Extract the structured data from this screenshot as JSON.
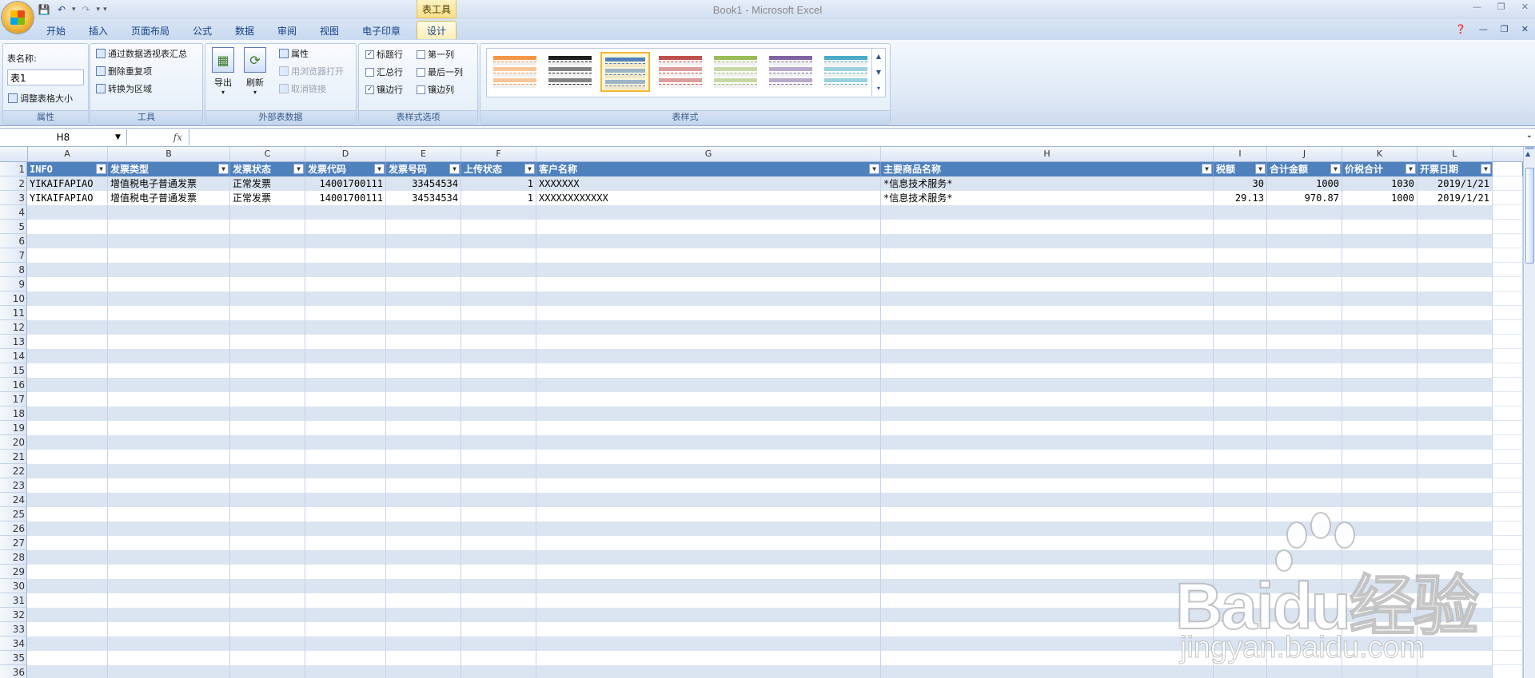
{
  "window": {
    "title": "Book1 - Microsoft Excel",
    "context_group": "表工具"
  },
  "tabs": [
    {
      "label": "开始"
    },
    {
      "label": "插入"
    },
    {
      "label": "页面布局"
    },
    {
      "label": "公式"
    },
    {
      "label": "数据"
    },
    {
      "label": "审阅"
    },
    {
      "label": "视图"
    },
    {
      "label": "电子印章"
    },
    {
      "label": "设计"
    }
  ],
  "active_tab": "设计",
  "ribbon": {
    "properties": {
      "label": "属性",
      "table_name_label": "表名称:",
      "table_name_value": "表1",
      "resize": "调整表格大小"
    },
    "tools": {
      "label": "工具",
      "pivot": "通过数据透视表汇总",
      "remove_dup": "删除重复项",
      "convert": "转换为区域"
    },
    "external": {
      "label": "外部表数据",
      "export": "导出",
      "refresh": "刷新",
      "props": "属性",
      "browser": "用浏览器打开",
      "unlink": "取消链接"
    },
    "style_options": {
      "label": "表样式选项",
      "header_row": "标题行",
      "total_row": "汇总行",
      "banded_rows": "镶边行",
      "first_col": "第一列",
      "last_col": "最后一列",
      "banded_cols": "镶边列",
      "header_row_checked": true,
      "total_row_checked": false,
      "banded_rows_checked": true,
      "first_col_checked": false,
      "last_col_checked": false,
      "banded_cols_checked": false
    },
    "styles": {
      "label": "表样式",
      "swatch_colors": [
        "#f79646",
        "#1f1f1f",
        "#4f81bd",
        "#c0504d",
        "#9bbb59",
        "#8064a2",
        "#4bacc6"
      ],
      "selected_index": 2
    }
  },
  "formula_bar": {
    "name_box": "H8",
    "fx": "fx",
    "formula": ""
  },
  "sheet": {
    "columns": [
      "A",
      "B",
      "C",
      "D",
      "E",
      "F",
      "G",
      "H",
      "I",
      "J",
      "K",
      "L"
    ],
    "header": [
      "INFO",
      "发票类型",
      "发票状态",
      "发票代码",
      "发票号码",
      "上传状态",
      "客户名称",
      "主要商品名称",
      "税额",
      "合计金额",
      "价税合计",
      "开票日期"
    ],
    "rows": [
      [
        "YIKAIFAPIAO",
        "增值税电子普通发票",
        "正常发票",
        "14001700111",
        "33454534",
        "1",
        "XXXXXXX",
        "*信息技术服务*",
        "30",
        "1000",
        "1030",
        "2019/1/21"
      ],
      [
        "YIKAIFAPIAO",
        "增值税电子普通发票",
        "正常发票",
        "14001700111",
        "34534534",
        "1",
        "XXXXXXXXXXXX",
        "*信息技术服务*",
        "29.13",
        "970.87",
        "1000",
        "2019/1/21"
      ]
    ],
    "row_numbers": [
      "1",
      "2",
      "3",
      "4",
      "5",
      "6",
      "7",
      "8",
      "9",
      "10",
      "11",
      "12",
      "13",
      "14",
      "15",
      "16",
      "17",
      "18",
      "19",
      "20",
      "21",
      "22",
      "23",
      "24",
      "25",
      "26",
      "27",
      "28",
      "29",
      "30",
      "31",
      "32",
      "33",
      "34",
      "35",
      "36"
    ]
  },
  "watermark": {
    "brand": "Baidu经验",
    "url": "jingyan.baidu.com"
  },
  "colors": {
    "header_fill": "#4f81bd",
    "band_fill": "#dbe5f1",
    "ribbon_bg": "#dde8f6"
  }
}
